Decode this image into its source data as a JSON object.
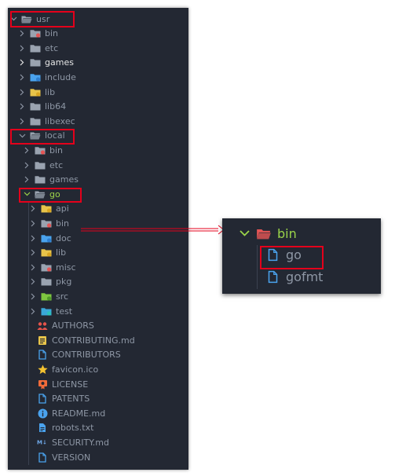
{
  "colors": {
    "panel_bg": "#232833",
    "folder": "#9aa3b0",
    "folder_red": "#e55555",
    "folder_blue": "#4aa3ee",
    "folder_yellow": "#e8c44a",
    "folder_green": "#7ec640",
    "go_green": "#9bd44a",
    "highlight": "#e4001b"
  },
  "tree": {
    "usr": {
      "label": "usr",
      "icon": "folder-open-icon"
    },
    "usr_children": [
      {
        "label": "bin",
        "icon": "folder-red-icon"
      },
      {
        "label": "etc",
        "icon": "folder-icon"
      },
      {
        "label": "games",
        "icon": "folder-icon"
      },
      {
        "label": "include",
        "icon": "folder-blue-icon"
      },
      {
        "label": "lib",
        "icon": "folder-yellow-icon"
      },
      {
        "label": "lib64",
        "icon": "folder-icon"
      },
      {
        "label": "libexec",
        "icon": "folder-icon"
      }
    ],
    "local": {
      "label": "local",
      "icon": "folder-open-icon"
    },
    "local_children": [
      {
        "label": "bin",
        "icon": "folder-red-icon"
      },
      {
        "label": "etc",
        "icon": "folder-icon"
      },
      {
        "label": "games",
        "icon": "folder-icon"
      }
    ],
    "go": {
      "label": "go",
      "icon": "folder-open-icon"
    },
    "go_folders": [
      {
        "label": "api",
        "icon": "folder-yellow-icon"
      },
      {
        "label": "bin",
        "icon": "folder-red-icon"
      },
      {
        "label": "doc",
        "icon": "folder-blue-icon"
      },
      {
        "label": "lib",
        "icon": "folder-yellow-icon"
      },
      {
        "label": "misc",
        "icon": "folder-red-icon"
      },
      {
        "label": "pkg",
        "icon": "folder-icon"
      },
      {
        "label": "src",
        "icon": "folder-green-icon"
      },
      {
        "label": "test",
        "icon": "folder-teal-icon"
      }
    ],
    "go_files": [
      {
        "label": "AUTHORS",
        "icon": "people-icon"
      },
      {
        "label": "CONTRIBUTING.md",
        "icon": "document-yellow-icon"
      },
      {
        "label": "CONTRIBUTORS",
        "icon": "file-icon"
      },
      {
        "label": "favicon.ico",
        "icon": "star-icon"
      },
      {
        "label": "LICENSE",
        "icon": "license-icon"
      },
      {
        "label": "PATENTS",
        "icon": "file-icon"
      },
      {
        "label": "README.md",
        "icon": "info-icon"
      },
      {
        "label": "robots.txt",
        "icon": "text-file-icon"
      },
      {
        "label": "SECURITY.md",
        "icon": "markdown-icon"
      },
      {
        "label": "VERSION",
        "icon": "file-icon"
      }
    ]
  },
  "zoom": {
    "folder": "bin",
    "files": [
      {
        "label": "go",
        "icon": "file-icon"
      },
      {
        "label": "gofmt",
        "icon": "file-icon"
      }
    ]
  }
}
